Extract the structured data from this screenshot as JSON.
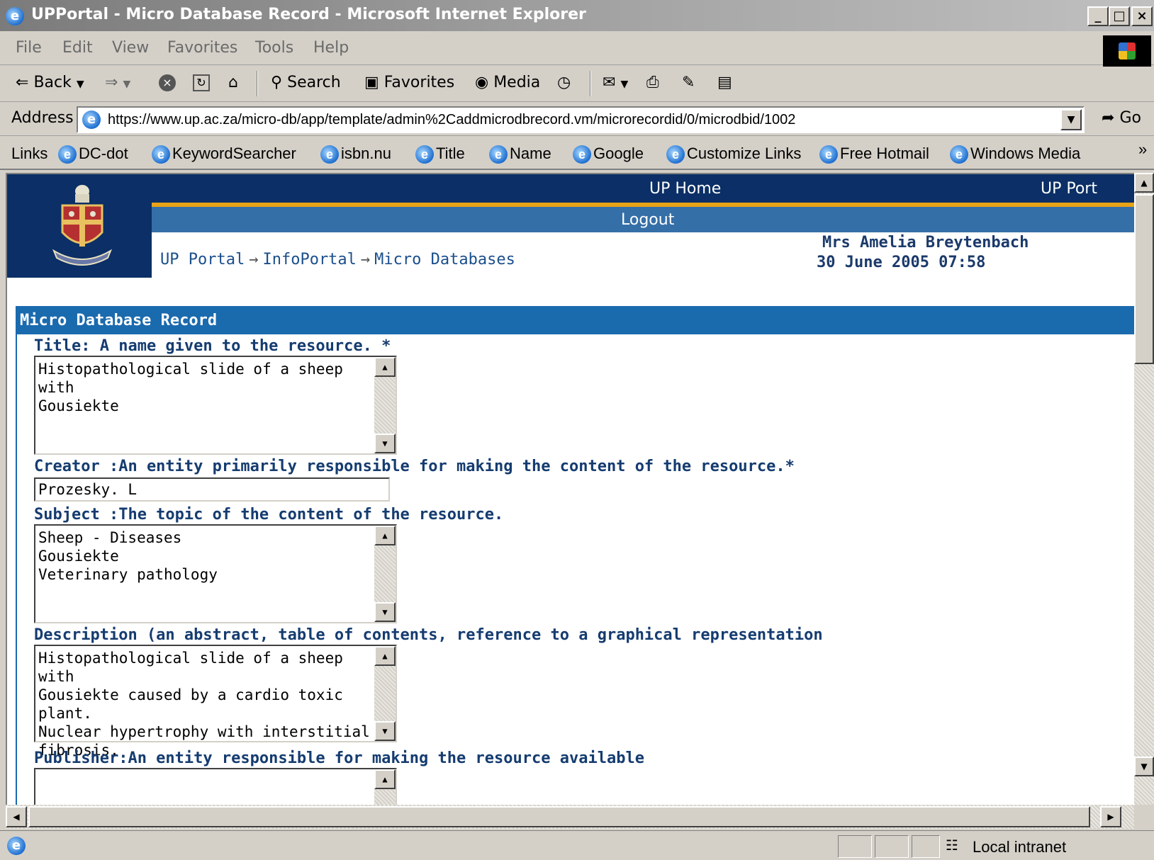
{
  "window": {
    "title": "UPPortal - Micro Database Record - Microsoft Internet Explorer",
    "minimize": "_",
    "maximize": "·",
    "close": "×"
  },
  "menu": [
    "File",
    "Edit",
    "View",
    "Favorites",
    "Tools",
    "Help"
  ],
  "toolbar": {
    "back": "Back",
    "search": "Search",
    "favorites": "Favorites",
    "media": "Media"
  },
  "address": {
    "label": "Address",
    "url": "https://www.up.ac.za/micro-db/app/template/admin%2Caddmicrodbrecord.vm/microrecordid/0/microdbid/1002",
    "go": "Go"
  },
  "links": {
    "label": "Links",
    "items": [
      "DC-dot",
      "KeywordSearcher",
      "isbn.nu",
      "Title",
      "Name",
      "Google",
      "Customize Links",
      "Free Hotmail",
      "Windows Media"
    ],
    "more": "»"
  },
  "portal": {
    "nav_home": "UP Home",
    "nav_portal": "UP Port",
    "logout": "Logout",
    "breadcrumb": [
      "UP Portal",
      "InfoPortal",
      "Micro Databases"
    ],
    "breadcrumb_sep": "→",
    "user": "Mrs Amelia Breytenbach",
    "datetime": "30 June 2005 07:58"
  },
  "form": {
    "section_title": "Micro Database Record",
    "title_label": "Title: A name given to the resource. *",
    "title_value": "Histopathological slide of a sheep with\nGousiekte",
    "creator_label": "Creator :An entity primarily responsible for making the content of the resource.*",
    "creator_value": "Prozesky. L",
    "subject_label": "Subject :The topic of the content of the resource.",
    "subject_value": "Sheep - Diseases\nGousiekte\nVeterinary pathology",
    "description_label": "Description (an abstract, table of contents, reference to a graphical representation",
    "description_value": "Histopathological slide of a sheep with\nGousiekte caused by a cardio toxic plant.\nNuclear hypertrophy with interstitial\nfibrosis.",
    "publisher_label": "Publisher:An entity responsible for making the resource available",
    "publisher_value": ""
  },
  "status": {
    "zone": "Local intranet"
  }
}
